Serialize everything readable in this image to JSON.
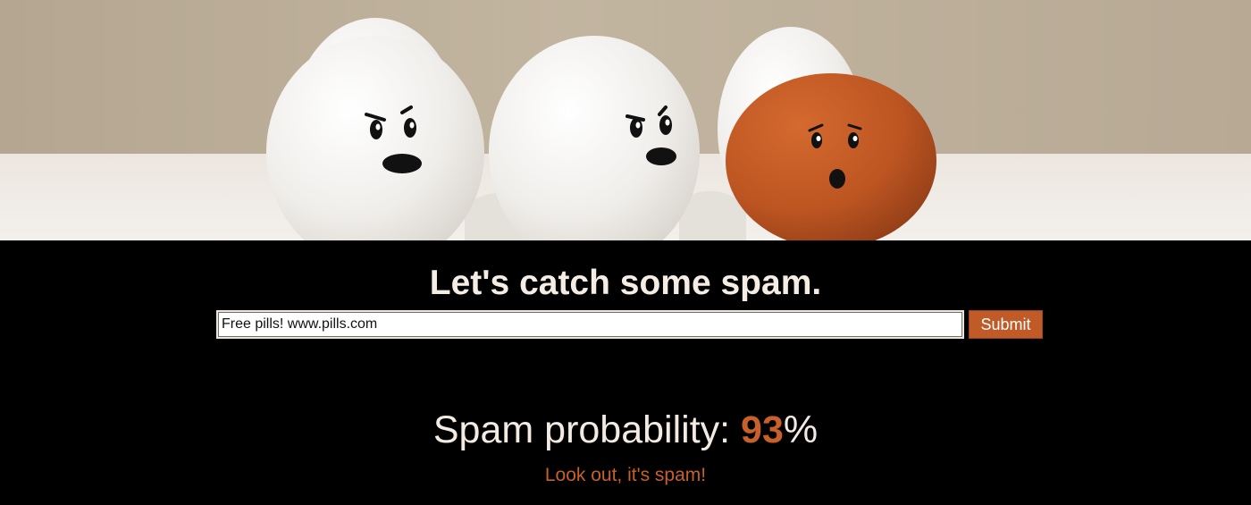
{
  "hero": {
    "image_name": "eggs-photo",
    "colors": {
      "background_wall": "#b9ab95",
      "background_table": "#eeeae6",
      "white_egg": "#f5f4f2",
      "brown_egg": "#c35b24"
    }
  },
  "form": {
    "heading": "Let's catch some spam.",
    "input_value": "Free pills! www.pills.com",
    "submit_label": "Submit"
  },
  "result": {
    "label": "Spam probability: ",
    "value": "93",
    "unit": "%",
    "verdict": "Look out, it's spam!"
  },
  "colors": {
    "accent": "#c8602a",
    "background": "#000000",
    "text": "#f5ece3"
  }
}
